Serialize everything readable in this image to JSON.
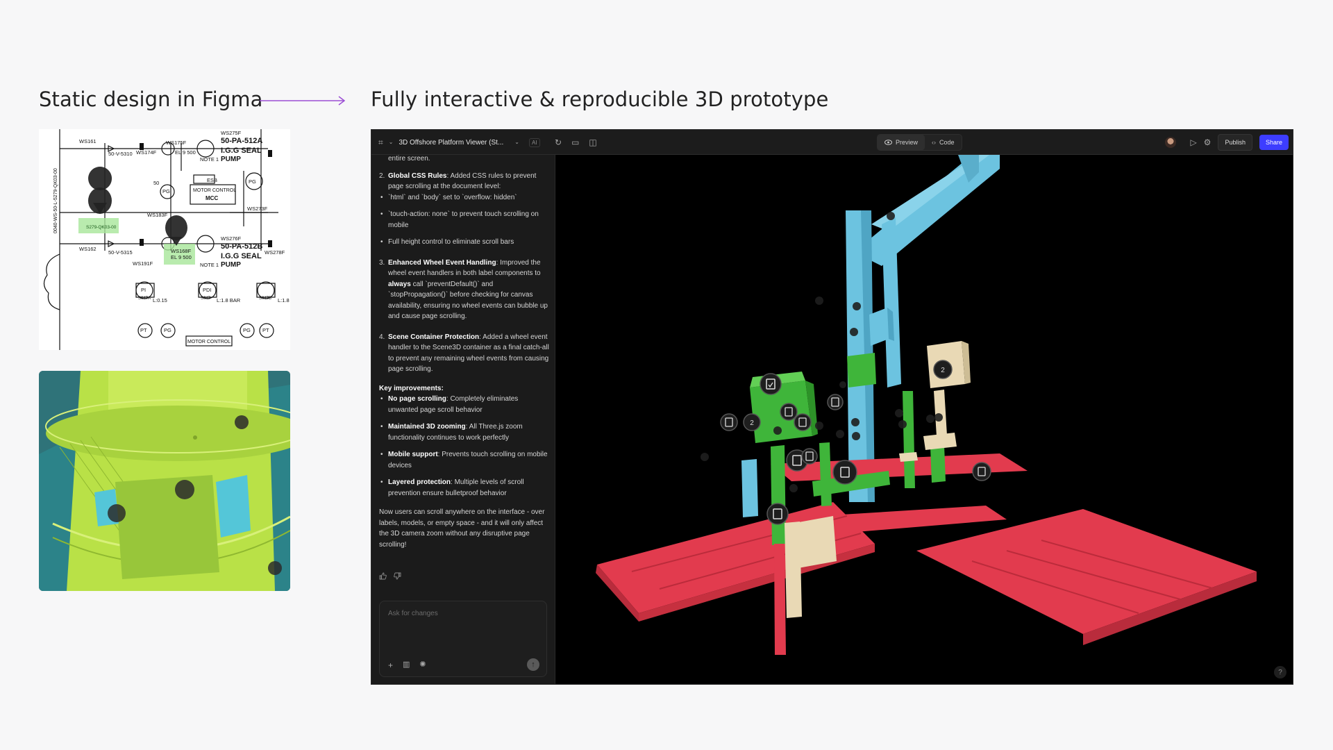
{
  "headings": {
    "left": "Static design in Figma",
    "right": "Fully interactive & reproducible 3D prototype"
  },
  "colors": {
    "accent_arrow": "#9b4fd4",
    "share": "#3d3dff",
    "platform_red": "#e23b4e",
    "pipe_blue": "#6cc2df",
    "equipment_green": "#3fb53a",
    "equipment_cream": "#e9d9b5",
    "hull_lime": "#b8e04a"
  },
  "pid": {
    "labels": [
      "WS161",
      "50-V-5310",
      "WS174F",
      "WS175F",
      "EL 9 500",
      "NOTE 1",
      "PUMP",
      "50-PA-512A",
      "I.G.G SEAL",
      "WS275F",
      "ESB",
      "MOTOR CONTROL",
      "MCC",
      "PG",
      "50",
      "WS273F",
      "PG",
      "WS183F",
      "WS162",
      "50-V-5315",
      "WS191F",
      "WS168F",
      "EL 9 500",
      "NOTE 1",
      "PUMP",
      "50-PA-512B",
      "I.G.G SEAL",
      "WS276F",
      "WS278F",
      "PI",
      "PDI",
      "L:1.8 BAR",
      "L:0.15",
      "PT",
      "PG",
      "PT",
      "PG",
      "MOTOR CONTROL",
      "0040-WS-50-L-5279-QK03-00",
      "S279-QK03-00",
      "S047A",
      "S047",
      "S047B",
      "L:1.8"
    ]
  },
  "app": {
    "title": "3D Offshore Platform Viewer (St...",
    "ai_badge": "AI",
    "tabs": [
      {
        "label": "Preview",
        "icon": "eye-icon"
      },
      {
        "label": "Code",
        "icon": "code-icon"
      }
    ],
    "publish_label": "Publish",
    "share_label": "Share",
    "help_label": "?"
  },
  "chat": {
    "continued": "entire screen.",
    "sections": [
      {
        "n": "2.",
        "title": "Global CSS Rules",
        "text": ": Added CSS rules to prevent page scrolling at the document level:",
        "bullets": [
          "`html` and `body` set to `overflow: hidden`",
          "`touch-action: none` to prevent touch scrolling on mobile",
          "Full height control to eliminate scroll bars"
        ]
      },
      {
        "n": "3.",
        "title": "Enhanced Wheel Event Handling",
        "text_a": ": Improved the wheel event handlers in both label components to ",
        "strong": "always",
        "text_b": " call `preventDefault()` and `stopPropagation()` before checking for canvas availability, ensuring no wheel events can bubble up and cause page scrolling."
      },
      {
        "n": "4.",
        "title": "Scene Container Protection",
        "text": ": Added a wheel event handler to the Scene3D container as a final catch-all to prevent any remaining wheel events from causing page scrolling."
      }
    ],
    "key_heading": "Key improvements:",
    "improvements": [
      {
        "title": "No page scrolling",
        "text": ": Completely eliminates unwanted page scroll behavior"
      },
      {
        "title": "Maintained 3D zooming",
        "text": ": All Three.js zoom functionality continues to work perfectly"
      },
      {
        "title": "Mobile support",
        "text": ": Prevents touch scrolling on mobile devices"
      },
      {
        "title": "Layered protection",
        "text": ": Multiple levels of scroll prevention ensure bulletproof behavior"
      }
    ],
    "outro": "Now users can scroll anywhere on the interface - over labels, models, or empty space - and it will only affect the 3D camera zoom without any disruptive page scrolling!",
    "composer_placeholder": "Ask for changes"
  },
  "scene": {
    "count_badges": [
      "2",
      "2"
    ]
  }
}
